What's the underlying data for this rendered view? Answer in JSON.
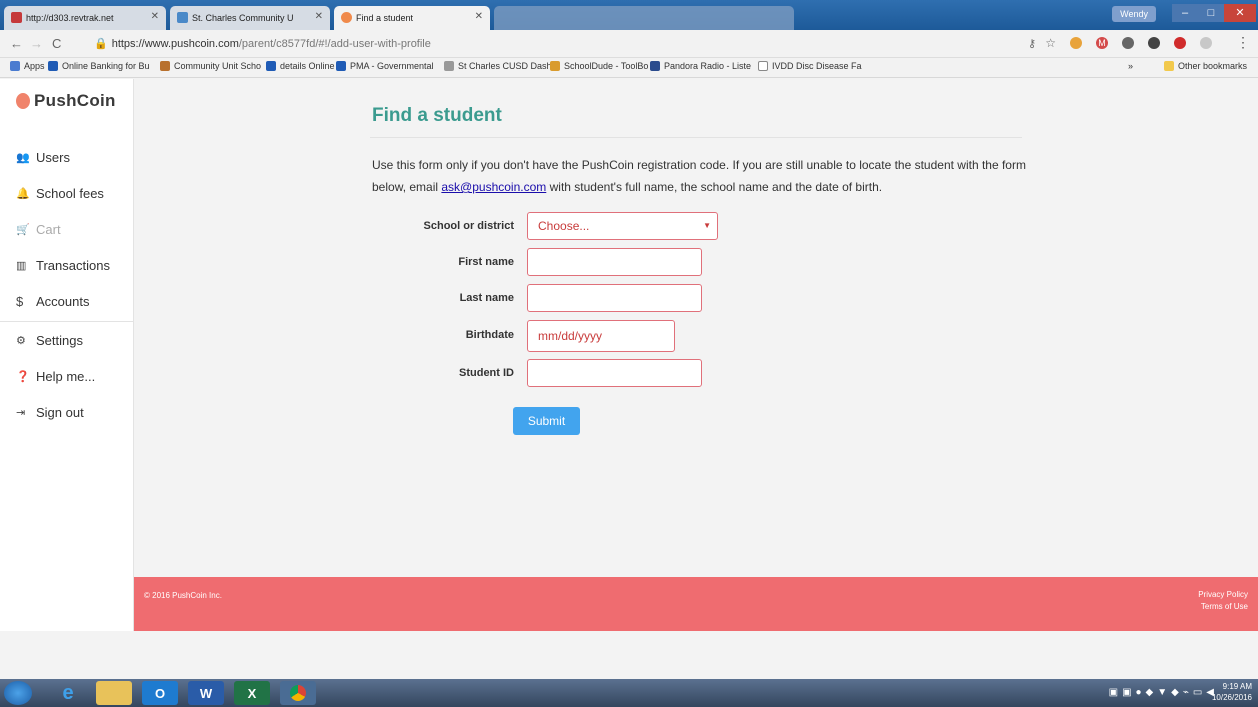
{
  "browser": {
    "tabs": [
      {
        "title": "http://d303.revtrak.net",
        "active": false
      },
      {
        "title": "St. Charles Community U",
        "active": false
      },
      {
        "title": "Find a student",
        "active": true
      }
    ],
    "user_badge": "Wendy",
    "url_host": "https://www.pushcoin.com",
    "url_path": "/parent/c8577fd/#!/add-user-with-profile",
    "bookmarks": [
      "Apps",
      "Online Banking for Bu",
      "Community Unit Scho",
      "details Online",
      "PMA - Governmental",
      "St Charles CUSD Dash",
      "SchoolDude - ToolBo",
      "Pandora Radio - Liste",
      "IVDD Disc Disease Fa",
      "»",
      "Other bookmarks"
    ]
  },
  "sidebar": {
    "logo": "PushCoin",
    "items": [
      {
        "label": "Users",
        "icon": "users-icon"
      },
      {
        "label": "School fees",
        "icon": "bell-icon"
      },
      {
        "label": "Cart",
        "icon": "cart-icon"
      },
      {
        "label": "Transactions",
        "icon": "bar-chart-icon"
      },
      {
        "label": "Accounts",
        "icon": "dollar-icon"
      },
      {
        "label": "Settings",
        "icon": "gears-icon"
      },
      {
        "label": "Help me...",
        "icon": "help-icon"
      },
      {
        "label": "Sign out",
        "icon": "sign-out-icon"
      }
    ]
  },
  "main": {
    "title": "Find a student",
    "intro_before_link": "Use this form only if you don't have the PushCoin registration code. If you are still unable to locate the student with the form below, email ",
    "intro_link": "ask@pushcoin.com",
    "intro_after_link": " with student's full name, the school name and the date of birth.",
    "form": {
      "school_label": "School or district",
      "school_value": "Choose...",
      "first_name_label": "First name",
      "last_name_label": "Last name",
      "birthdate_label": "Birthdate",
      "birthdate_placeholder": "mm/dd/yyyy",
      "student_id_label": "Student ID",
      "submit_label": "Submit"
    }
  },
  "footer": {
    "copyright": "© 2016 PushCoin Inc.",
    "privacy": "Privacy Policy",
    "terms": "Terms of Use"
  },
  "taskbar": {
    "time": "9:19 AM",
    "date": "10/26/2016"
  },
  "colors": {
    "accent_teal": "#3b9b8f",
    "footer_red": "#ef6c70",
    "submit_blue": "#42a4ee",
    "field_border": "#e0707a"
  }
}
